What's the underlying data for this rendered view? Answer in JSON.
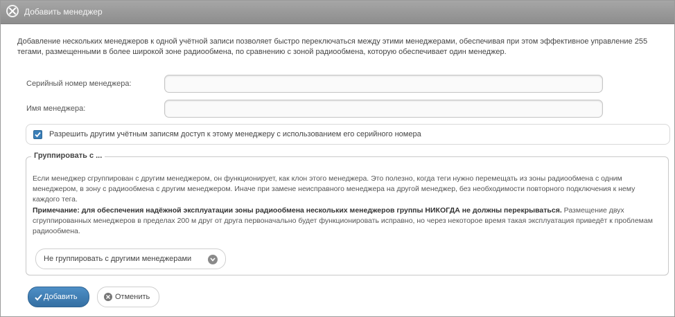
{
  "dialog": {
    "title": "Добавить менеджер",
    "intro": "Добавление нескольких менеджеров к одной учётной записи позволяет быстро переключаться между этими менеджерами, обеспечивая при этом эффективное управление 255 тегами, размещенными в более широкой зоне радиообмена, по сравнению с зоной радиообмена, которую обеспечивает один менеджер."
  },
  "form": {
    "serial_label": "Серийный номер менеджера:",
    "serial_value": "",
    "name_label": "Имя менеджера:",
    "name_value": ""
  },
  "permission": {
    "checked": true,
    "label": "Разрешить другим учётным записям доступ к этому менеджеру с использованием его серийного номера"
  },
  "group": {
    "legend": "Группировать с ...",
    "description": "Если менеджер сгруппирован с другим менеджером, он функционирует, как клон этого менеджера. Это полезно, когда теги нужно перемещать из зоны радиообмена с одним менеджером, в зону с радиообмена с другим менеджером. Иначе при замене неисправного менеджера на другой менеджер, без необходимости повторного подключения к нему каждого тега.",
    "note_bold": "Примечание: для обеспечения надёжной эксплуатации зоны радиообмена нескольких менеджеров группы НИКОГДА не должны перекрываться.",
    "note_rest": " Размещение двух сгруппированных менеджеров в пределах 200 м друг от друга первоначально будет функционировать исправно, но через некоторое время такая эксплуатация приведёт к проблемам радиообмена.",
    "select_value": "Не группировать с другими менеджерами"
  },
  "buttons": {
    "add_label": "Добавить",
    "cancel_label": "Отменить"
  },
  "colors": {
    "titlebar": "#999999",
    "primary": "#3b7fb8"
  },
  "icons": [
    "close-icon",
    "checkbox-check-icon",
    "chevron-down-icon",
    "check-icon",
    "cancel-icon"
  ]
}
